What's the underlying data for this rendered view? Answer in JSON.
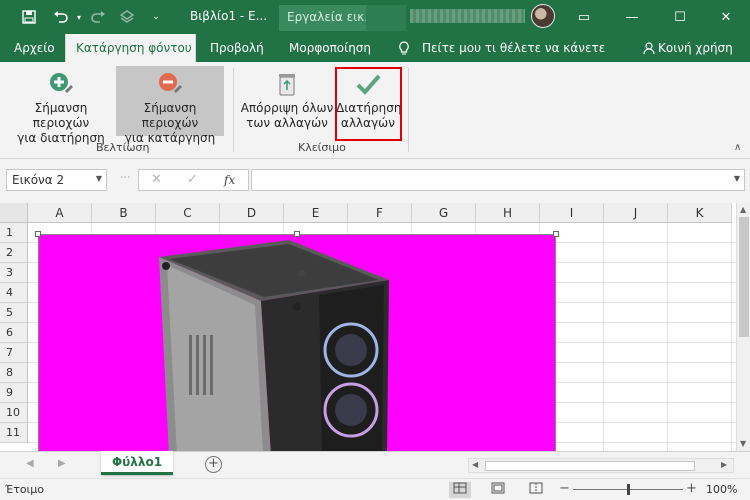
{
  "titlebar": {
    "doc_title": "Βιβλίο1 - Ε...",
    "context_tools": "Εργαλεία εικ...",
    "icons": [
      "save-icon",
      "undo-icon",
      "redo-icon",
      "touch-mode-icon",
      "customize-toolbar-icon"
    ],
    "window_buttons": {
      "ribbon_display": "▭",
      "minimize": "—",
      "maximize": "☐",
      "close": "✕"
    }
  },
  "tabs": {
    "file": "Αρχείο",
    "remove_background": "Κατάργηση φόντου",
    "view": "Προβολή",
    "format": "Μορφοποίηση",
    "tell_me": "Πείτε μου τι θέλετε να κάνετε",
    "share": "Κοινή χρήση"
  },
  "ribbon": {
    "mark_keep_line1": "Σήμανση περιοχών",
    "mark_keep_line2": "για διατήρηση",
    "mark_remove_line1": "Σήμανση περιοχών",
    "mark_remove_line2": "για κατάργηση",
    "group_refine": "Βελτίωση",
    "discard_line1": "Απόρριψη όλων",
    "discard_line2": "των αλλαγών",
    "keep_line1": "Διατήρηση",
    "keep_line2": "αλλαγών",
    "group_close": "Κλείσιμο",
    "collapse_glyph": "∧"
  },
  "formula_bar": {
    "name_box": "Εικόνα 2",
    "cancel_glyph": "✕",
    "enter_glyph": "✓",
    "fx_glyph": "fx",
    "formula_value": ""
  },
  "grid": {
    "columns": [
      "A",
      "B",
      "C",
      "D",
      "E",
      "F",
      "G",
      "H",
      "I",
      "J",
      "K"
    ],
    "rows": [
      "1",
      "2",
      "3",
      "4",
      "5",
      "6",
      "7",
      "8",
      "9",
      "10",
      "11"
    ]
  },
  "picture": {
    "background_color": "#ff00ff",
    "subject": "computer-case-image"
  },
  "sheets": {
    "tabs": [
      "Φύλλο1"
    ],
    "add_glyph": "+"
  },
  "status": {
    "ready": "Έτοιμο",
    "zoom_minus": "−",
    "zoom_plus": "+",
    "zoom_level": "100%",
    "zoom_value": 0.5
  },
  "colors": {
    "accent": "#217346",
    "highlight_box": "#e00000",
    "pressed_button": "#c6c6c6"
  }
}
